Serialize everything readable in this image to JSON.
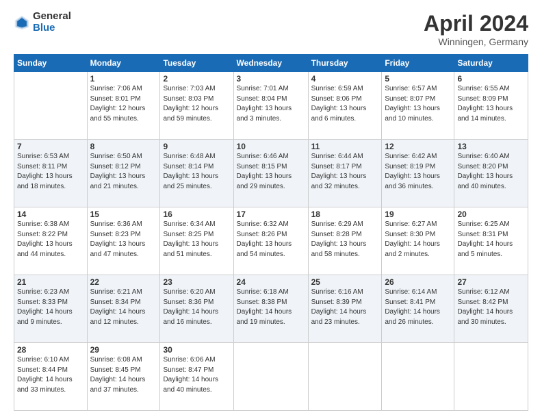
{
  "logo": {
    "general": "General",
    "blue": "Blue"
  },
  "title": "April 2024",
  "subtitle": "Winningen, Germany",
  "days_header": [
    "Sunday",
    "Monday",
    "Tuesday",
    "Wednesday",
    "Thursday",
    "Friday",
    "Saturday"
  ],
  "weeks": [
    {
      "shaded": false,
      "days": [
        {
          "num": "",
          "sunrise": "",
          "sunset": "",
          "daylight": ""
        },
        {
          "num": "1",
          "sunrise": "Sunrise: 7:06 AM",
          "sunset": "Sunset: 8:01 PM",
          "daylight": "Daylight: 12 hours and 55 minutes."
        },
        {
          "num": "2",
          "sunrise": "Sunrise: 7:03 AM",
          "sunset": "Sunset: 8:03 PM",
          "daylight": "Daylight: 12 hours and 59 minutes."
        },
        {
          "num": "3",
          "sunrise": "Sunrise: 7:01 AM",
          "sunset": "Sunset: 8:04 PM",
          "daylight": "Daylight: 13 hours and 3 minutes."
        },
        {
          "num": "4",
          "sunrise": "Sunrise: 6:59 AM",
          "sunset": "Sunset: 8:06 PM",
          "daylight": "Daylight: 13 hours and 6 minutes."
        },
        {
          "num": "5",
          "sunrise": "Sunrise: 6:57 AM",
          "sunset": "Sunset: 8:07 PM",
          "daylight": "Daylight: 13 hours and 10 minutes."
        },
        {
          "num": "6",
          "sunrise": "Sunrise: 6:55 AM",
          "sunset": "Sunset: 8:09 PM",
          "daylight": "Daylight: 13 hours and 14 minutes."
        }
      ]
    },
    {
      "shaded": true,
      "days": [
        {
          "num": "7",
          "sunrise": "Sunrise: 6:53 AM",
          "sunset": "Sunset: 8:11 PM",
          "daylight": "Daylight: 13 hours and 18 minutes."
        },
        {
          "num": "8",
          "sunrise": "Sunrise: 6:50 AM",
          "sunset": "Sunset: 8:12 PM",
          "daylight": "Daylight: 13 hours and 21 minutes."
        },
        {
          "num": "9",
          "sunrise": "Sunrise: 6:48 AM",
          "sunset": "Sunset: 8:14 PM",
          "daylight": "Daylight: 13 hours and 25 minutes."
        },
        {
          "num": "10",
          "sunrise": "Sunrise: 6:46 AM",
          "sunset": "Sunset: 8:15 PM",
          "daylight": "Daylight: 13 hours and 29 minutes."
        },
        {
          "num": "11",
          "sunrise": "Sunrise: 6:44 AM",
          "sunset": "Sunset: 8:17 PM",
          "daylight": "Daylight: 13 hours and 32 minutes."
        },
        {
          "num": "12",
          "sunrise": "Sunrise: 6:42 AM",
          "sunset": "Sunset: 8:19 PM",
          "daylight": "Daylight: 13 hours and 36 minutes."
        },
        {
          "num": "13",
          "sunrise": "Sunrise: 6:40 AM",
          "sunset": "Sunset: 8:20 PM",
          "daylight": "Daylight: 13 hours and 40 minutes."
        }
      ]
    },
    {
      "shaded": false,
      "days": [
        {
          "num": "14",
          "sunrise": "Sunrise: 6:38 AM",
          "sunset": "Sunset: 8:22 PM",
          "daylight": "Daylight: 13 hours and 44 minutes."
        },
        {
          "num": "15",
          "sunrise": "Sunrise: 6:36 AM",
          "sunset": "Sunset: 8:23 PM",
          "daylight": "Daylight: 13 hours and 47 minutes."
        },
        {
          "num": "16",
          "sunrise": "Sunrise: 6:34 AM",
          "sunset": "Sunset: 8:25 PM",
          "daylight": "Daylight: 13 hours and 51 minutes."
        },
        {
          "num": "17",
          "sunrise": "Sunrise: 6:32 AM",
          "sunset": "Sunset: 8:26 PM",
          "daylight": "Daylight: 13 hours and 54 minutes."
        },
        {
          "num": "18",
          "sunrise": "Sunrise: 6:29 AM",
          "sunset": "Sunset: 8:28 PM",
          "daylight": "Daylight: 13 hours and 58 minutes."
        },
        {
          "num": "19",
          "sunrise": "Sunrise: 6:27 AM",
          "sunset": "Sunset: 8:30 PM",
          "daylight": "Daylight: 14 hours and 2 minutes."
        },
        {
          "num": "20",
          "sunrise": "Sunrise: 6:25 AM",
          "sunset": "Sunset: 8:31 PM",
          "daylight": "Daylight: 14 hours and 5 minutes."
        }
      ]
    },
    {
      "shaded": true,
      "days": [
        {
          "num": "21",
          "sunrise": "Sunrise: 6:23 AM",
          "sunset": "Sunset: 8:33 PM",
          "daylight": "Daylight: 14 hours and 9 minutes."
        },
        {
          "num": "22",
          "sunrise": "Sunrise: 6:21 AM",
          "sunset": "Sunset: 8:34 PM",
          "daylight": "Daylight: 14 hours and 12 minutes."
        },
        {
          "num": "23",
          "sunrise": "Sunrise: 6:20 AM",
          "sunset": "Sunset: 8:36 PM",
          "daylight": "Daylight: 14 hours and 16 minutes."
        },
        {
          "num": "24",
          "sunrise": "Sunrise: 6:18 AM",
          "sunset": "Sunset: 8:38 PM",
          "daylight": "Daylight: 14 hours and 19 minutes."
        },
        {
          "num": "25",
          "sunrise": "Sunrise: 6:16 AM",
          "sunset": "Sunset: 8:39 PM",
          "daylight": "Daylight: 14 hours and 23 minutes."
        },
        {
          "num": "26",
          "sunrise": "Sunrise: 6:14 AM",
          "sunset": "Sunset: 8:41 PM",
          "daylight": "Daylight: 14 hours and 26 minutes."
        },
        {
          "num": "27",
          "sunrise": "Sunrise: 6:12 AM",
          "sunset": "Sunset: 8:42 PM",
          "daylight": "Daylight: 14 hours and 30 minutes."
        }
      ]
    },
    {
      "shaded": false,
      "days": [
        {
          "num": "28",
          "sunrise": "Sunrise: 6:10 AM",
          "sunset": "Sunset: 8:44 PM",
          "daylight": "Daylight: 14 hours and 33 minutes."
        },
        {
          "num": "29",
          "sunrise": "Sunrise: 6:08 AM",
          "sunset": "Sunset: 8:45 PM",
          "daylight": "Daylight: 14 hours and 37 minutes."
        },
        {
          "num": "30",
          "sunrise": "Sunrise: 6:06 AM",
          "sunset": "Sunset: 8:47 PM",
          "daylight": "Daylight: 14 hours and 40 minutes."
        },
        {
          "num": "",
          "sunrise": "",
          "sunset": "",
          "daylight": ""
        },
        {
          "num": "",
          "sunrise": "",
          "sunset": "",
          "daylight": ""
        },
        {
          "num": "",
          "sunrise": "",
          "sunset": "",
          "daylight": ""
        },
        {
          "num": "",
          "sunrise": "",
          "sunset": "",
          "daylight": ""
        }
      ]
    }
  ]
}
